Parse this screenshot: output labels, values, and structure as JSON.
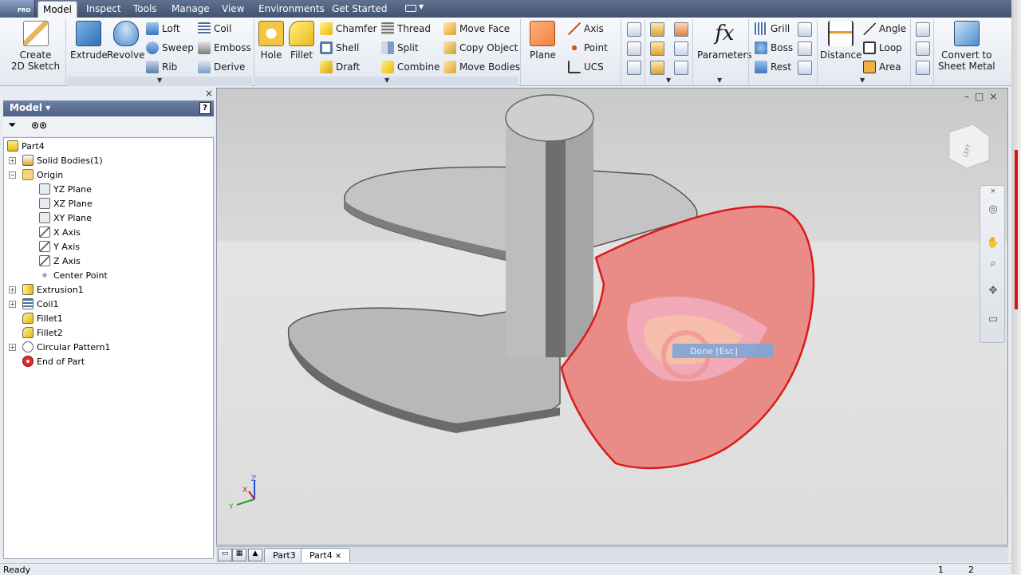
{
  "menu": {
    "app_badge": "PRO",
    "tabs": [
      {
        "label": "Inspect"
      },
      {
        "label": "Tools"
      },
      {
        "label": "Manage"
      },
      {
        "label": "View"
      },
      {
        "label": "Environments"
      },
      {
        "label": "Get Started"
      }
    ],
    "active_tab": "Model"
  },
  "ribbon": {
    "sketch": {
      "create_line1": "Create",
      "create_line2": "2D Sketch"
    },
    "create": {
      "extrude": "Extrude",
      "revolve": "Revolve",
      "loft": "Loft",
      "sweep": "Sweep",
      "rib": "Rib",
      "coil": "Coil",
      "emboss": "Emboss",
      "derive": "Derive"
    },
    "modify": {
      "hole": "Hole",
      "fillet": "Fillet",
      "chamfer": "Chamfer",
      "shell": "Shell",
      "draft": "Draft",
      "thread": "Thread",
      "split": "Split",
      "combine": "Combine",
      "move_face": "Move Face",
      "copy_object": "Copy Object",
      "move_bodies": "Move Bodies"
    },
    "work_features": {
      "plane": "Plane",
      "axis": "Axis",
      "point": "Point",
      "ucs": "UCS"
    },
    "parameters": {
      "fx": "fx",
      "label": "Parameters"
    },
    "plastic": {
      "grill": "Grill",
      "boss": "Boss",
      "rest": "Rest"
    },
    "measure": {
      "distance": "Distance",
      "angle": "Angle",
      "loop": "Loop",
      "area": "Area"
    },
    "convert": {
      "line1": "Convert to",
      "line2": "Sheet Metal"
    }
  },
  "browser": {
    "title": "Model",
    "help": "?",
    "close": "×",
    "tree": [
      {
        "label": "Part4"
      },
      {
        "label": "Solid Bodies(1)"
      },
      {
        "label": "Origin"
      },
      {
        "label": "YZ Plane"
      },
      {
        "label": "XZ Plane"
      },
      {
        "label": "XY Plane"
      },
      {
        "label": "X Axis"
      },
      {
        "label": "Y Axis"
      },
      {
        "label": "Z Axis"
      },
      {
        "label": "Center Point"
      },
      {
        "label": "Extrusion1"
      },
      {
        "label": "Coil1"
      },
      {
        "label": "Fillet1"
      },
      {
        "label": "Fillet2"
      },
      {
        "label": "Circular Pattern1"
      },
      {
        "label": "End of Part"
      }
    ]
  },
  "viewport": {
    "context_menu": "Done  [Esc]",
    "viewcube_label": "LEFT",
    "triad": {
      "x": "X",
      "y": "Y",
      "z": "Z"
    }
  },
  "doc_tabs": [
    {
      "label": "Part3"
    },
    {
      "label": "Part4"
    }
  ],
  "status": {
    "text": "Ready",
    "count1": "1",
    "count2": "2"
  },
  "colors": {
    "accent": "#4d6088",
    "selection": "#e03030",
    "face_highlight": "#e87c7c"
  }
}
